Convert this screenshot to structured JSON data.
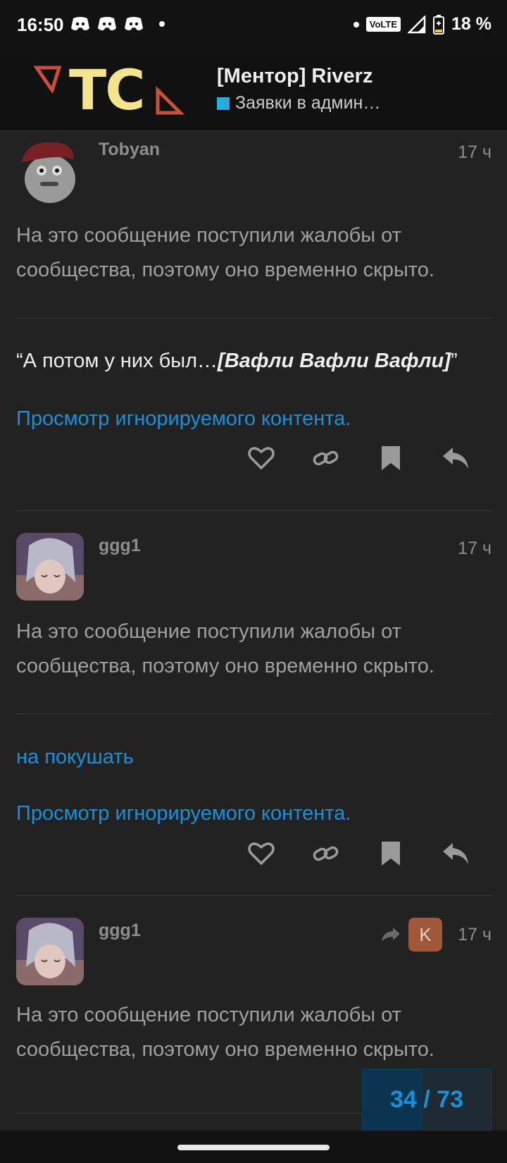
{
  "status_bar": {
    "time": "16:50",
    "battery": "18 %",
    "network_badge": "VoLTE",
    "icons": [
      "discord-icon",
      "discord-icon",
      "discord-icon",
      "dot",
      "dot",
      "signal-icon",
      "battery-icon"
    ]
  },
  "header": {
    "logo_text": "TC",
    "title": "[Ментор] Riverz",
    "category": "Заявки в админ…",
    "category_color": "#25aae1"
  },
  "posts": [
    {
      "username": "Tobyan",
      "time": "17 ч",
      "hidden_text": "На это сообщение поступили жалобы от сообщества, поэтому оно временно скрыто.",
      "quote_open": "“А потом у них был…",
      "quote_bold": "[Вафли Вафли Вафли]",
      "quote_close": "”",
      "ignored_link": "Просмотр игнорируемого контента."
    },
    {
      "username": "ggg1",
      "time": "17 ч",
      "hidden_text": "На это сообщение поступили жалобы от сообщества, поэтому оно временно скрыто.",
      "body_link": "на покушать",
      "ignored_link": "Просмотр игнорируемого контента."
    },
    {
      "username": "ggg1",
      "time": "17 ч",
      "reply_to_initial": "K",
      "hidden_text": "На это сообщение поступили жалобы от сообщества, поэтому оно временно скрыто."
    }
  ],
  "progress": {
    "current": "34",
    "separator": " / ",
    "total": "73",
    "fraction": 0.466
  },
  "colors": {
    "accent": "#1b8fd8",
    "background": "#222222",
    "header_bg": "#111111",
    "logo_yellow": "#f4e58c",
    "logo_red": "#c8503c"
  }
}
